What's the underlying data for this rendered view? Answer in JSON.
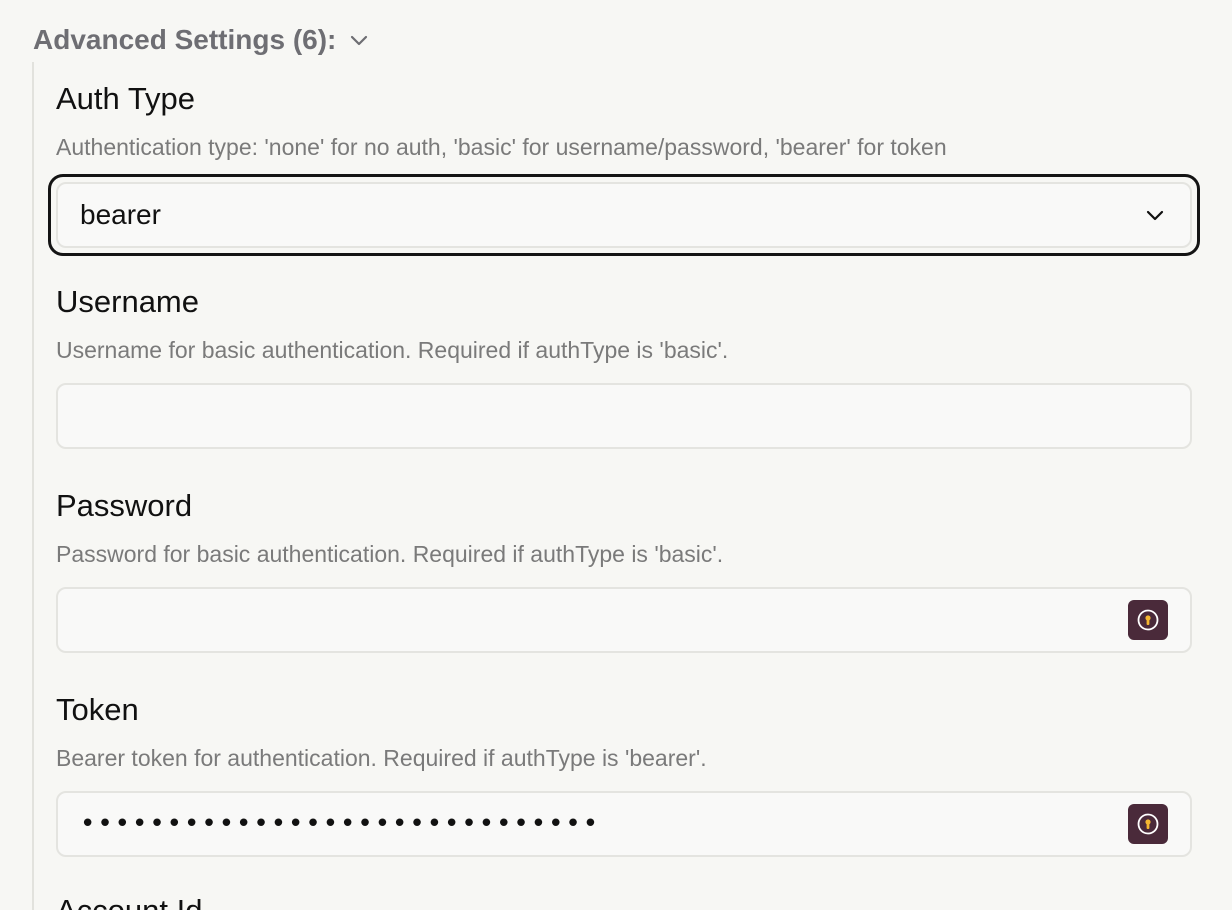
{
  "section": {
    "title": "Advanced Settings (6):"
  },
  "fields": {
    "auth_type": {
      "label": "Auth Type",
      "description": "Authentication type: 'none' for no auth, 'basic' for username/password, 'bearer' for token",
      "value": "bearer"
    },
    "username": {
      "label": "Username",
      "description": "Username for basic authentication. Required if authType is 'basic'.",
      "value": ""
    },
    "password": {
      "label": "Password",
      "description": "Password for basic authentication. Required if authType is 'basic'.",
      "value": ""
    },
    "token": {
      "label": "Token",
      "description": "Bearer token for authentication. Required if authType is 'bearer'.",
      "masked_value": "••••••••••••••••••••••••••••••"
    },
    "account_id": {
      "label": "Account Id"
    }
  },
  "icons": {
    "section_toggle": "chevron-down-icon",
    "select_toggle": "chevron-down-icon",
    "password_manager": "password-manager-icon"
  },
  "colors": {
    "background": "#f7f7f4",
    "focus_border": "#141414",
    "password_manager_icon_bg": "#4a2a3a",
    "password_manager_icon_accent": "#f5b731"
  }
}
